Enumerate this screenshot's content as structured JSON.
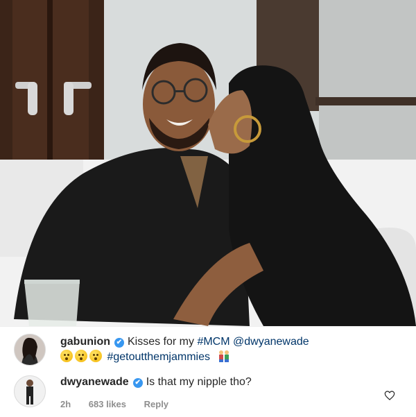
{
  "post": {
    "photo_icon": "post-photo"
  },
  "comments": [
    {
      "username": "gabunion",
      "verified_mark": "✔",
      "text": "Kisses for my",
      "hashtag1": "#MCM",
      "mention": "@dwyanewade",
      "hashtag2": "#getoutthemjammies",
      "emoji_names": [
        "astonished-face-emoji",
        "astonished-face-emoji",
        "astonished-face-emoji",
        "couple-emoji"
      ]
    },
    {
      "username": "dwyanewade",
      "verified_mark": "✔",
      "text": "Is that my nipple tho?",
      "time": "2h",
      "likes": "683 likes",
      "reply": "Reply"
    }
  ],
  "colors": {
    "verified": "#3897f0",
    "link": "#003569",
    "meta": "#8e8e8e"
  }
}
